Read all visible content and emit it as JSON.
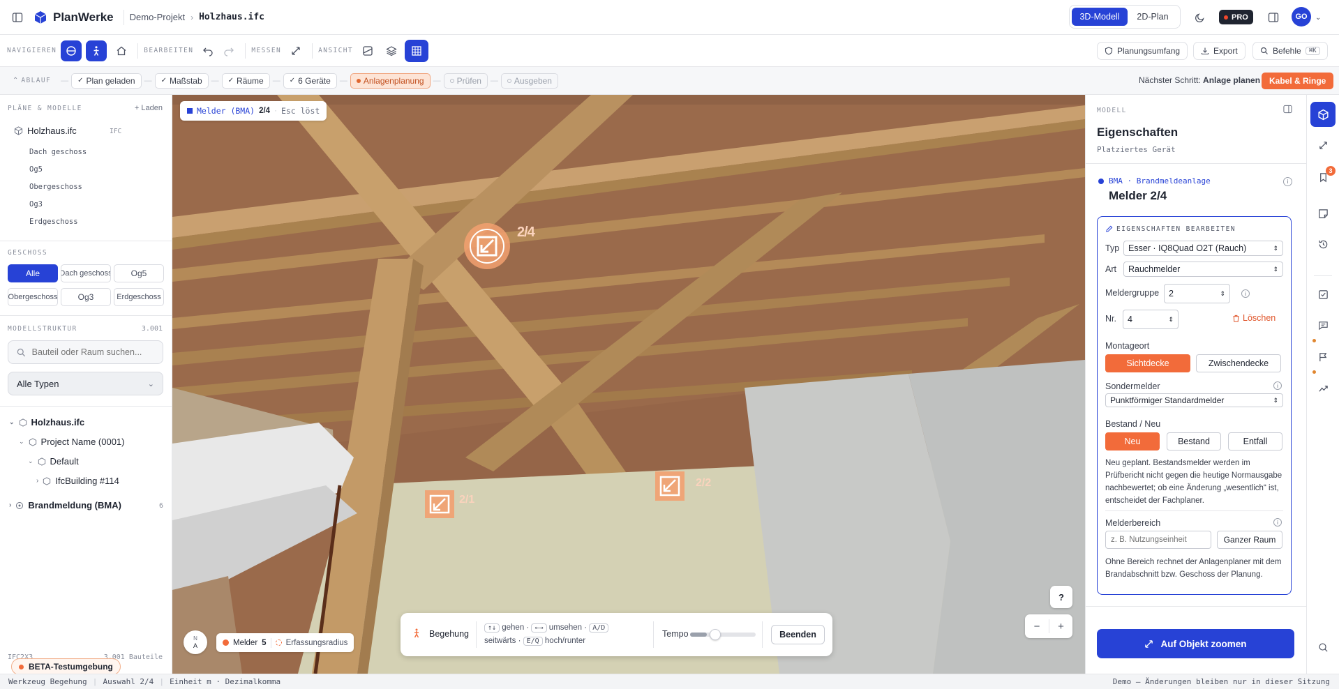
{
  "app": {
    "name": "PlanWerke",
    "breadcrumb_project": "Demo-Projekt",
    "breadcrumb_file": "Holzhaus.ifc",
    "view_3d": "3D-Modell",
    "view_2d": "2D-Plan",
    "pro_label": "PRO",
    "avatar": "GO",
    "accent": "#2742d6",
    "orange": "#f26b3a"
  },
  "toolbar": {
    "nav_label": "NAVIGIEREN",
    "edit_label": "BEARBEITEN",
    "measure_label": "MESSEN",
    "view_label": "ANSICHT",
    "scope_button": "Planungsumfang",
    "export_button": "Export",
    "commands_button": "Befehle",
    "commands_shortcut": "⌘K"
  },
  "workflow": {
    "label": "ABLAUF",
    "steps": [
      "Plan geladen",
      "Maßstab",
      "Räume",
      "6 Geräte",
      "Anlagenplanung",
      "Prüfen",
      "Ausgeben"
    ],
    "next_prefix": "Nächster Schritt:",
    "next_step": "Anlage planen",
    "next_button": "Kabel & Ringe"
  },
  "left": {
    "plans_title": "PLÄNE & MODELLE",
    "load_link": "+ Laden",
    "model_name": "Holzhaus.ifc",
    "model_badge": "IFC",
    "levels": [
      "Dach geschoss",
      "Og5",
      "Obergeschoss",
      "Og3",
      "Erdgeschoss"
    ],
    "floor_title": "GESCHOSS",
    "floor_buttons": [
      "Alle",
      "Dach geschoss",
      "Og5",
      "Obergeschoss",
      "Og3",
      "Erdgeschoss"
    ],
    "structure_title": "MODELLSTRUKTUR",
    "structure_count": "3.001",
    "search_placeholder": "Bauteil oder Raum suchen...",
    "type_select": "Alle Typen",
    "tree": {
      "root": "Holzhaus.ifc",
      "project": "Project Name (0001)",
      "default": "Default",
      "building": "IfcBuilding #114",
      "bma": "Brandmeldung (BMA)",
      "bma_count": "6"
    },
    "footer_left": "IFC2X3",
    "footer_right": "3.001 Bauteile",
    "beta_label": "BETA-Testumgebung"
  },
  "viewport": {
    "mode_label": "Melder (BMA)",
    "mode_index": "2/4",
    "mode_hint": "Esc löst",
    "markers": [
      "2/4",
      "2/1",
      "2/2"
    ],
    "legend_label": "Melder",
    "legend_count": "5",
    "radius_label": "Erfassungsradius",
    "walk_label": "Begehung",
    "walk_keys": [
      "↑↓",
      "←→",
      "A/D",
      "E/Q"
    ],
    "walk_text": [
      "gehen ·",
      "umsehen ·",
      "seitwärts ·",
      "hoch/runter"
    ],
    "tempo_label": "Tempo",
    "tempo_value": 0.25,
    "end_button": "Beenden",
    "compass": "N",
    "compass_sub": "A",
    "help": "?",
    "zoom_out": "−",
    "zoom_in": "+"
  },
  "right": {
    "section": "MODELL",
    "title": "Eigenschaften",
    "subtitle": "Platziertes Gerät",
    "device_system": "BMA · Brandmeldeanlage",
    "device_title": "Melder 2/4",
    "edit_title": "EIGENSCHAFTEN BEARBEITEN",
    "type_label": "Typ",
    "type_value": "Esser · IQ8Quad O2T (Rauch)",
    "kind_label": "Art",
    "kind_value": "Rauchmelder",
    "group_label": "Meldergruppe",
    "group_value": "2",
    "nr_label": "Nr.",
    "nr_value": "4",
    "delete_button": "Löschen",
    "mount_label": "Montageort",
    "mount_options": [
      "Sichtdecke",
      "Zwischendecke"
    ],
    "special_label": "Sondermelder",
    "special_value": "Punktförmiger Standardmelder",
    "state_label": "Bestand / Neu",
    "state_options": [
      "Neu",
      "Bestand",
      "Entfall"
    ],
    "state_note": "Neu geplant. Bestandsmelder werden im Prüfbericht nicht gegen die heutige Normausgabe nachbewertet; ob eine Änderung „wesentlich“ ist, entscheidet der Fachplaner.",
    "area_label": "Melderbereich",
    "area_placeholder": "z. B. Nutzungseinheit",
    "area_button": "Ganzer Raum",
    "area_note": "Ohne Bereich rechnet der Anlagenplaner mit dem Brandabschnitt bzw. Geschoss der Planung.",
    "zoom_button": "Auf Objekt zoomen"
  },
  "rail": {
    "badge": "3"
  },
  "status": {
    "tool": "Werkzeug Begehung",
    "selection": "Auswahl 2/4",
    "units": "Einheit m · Dezimalkomma",
    "demo_note": "Demo — Änderungen bleiben nur in dieser Sitzung"
  }
}
